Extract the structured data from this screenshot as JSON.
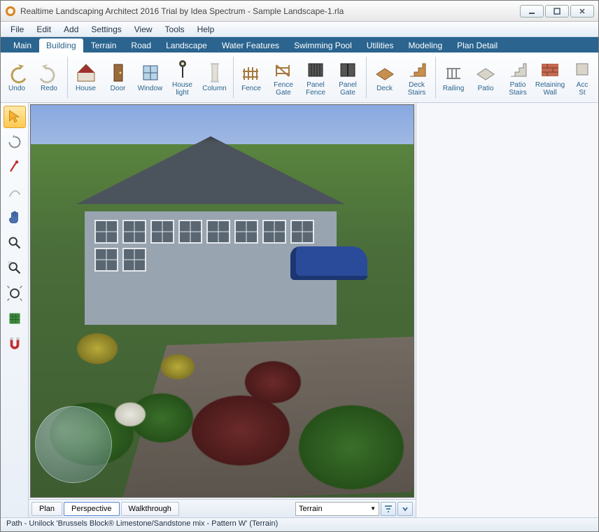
{
  "title": "Realtime Landscaping Architect 2016 Trial by Idea Spectrum - Sample Landscape-1.rla",
  "menus": [
    "File",
    "Edit",
    "Add",
    "Settings",
    "View",
    "Tools",
    "Help"
  ],
  "ribbon_tabs": [
    "Main",
    "Building",
    "Terrain",
    "Road",
    "Landscape",
    "Water Features",
    "Swimming Pool",
    "Utilities",
    "Modeling",
    "Plan Detail"
  ],
  "active_ribbon": 1,
  "tools_history": [
    {
      "label": "Undo",
      "icon": "undo-icon"
    },
    {
      "label": "Redo",
      "icon": "redo-icon"
    }
  ],
  "tools_building": [
    {
      "label": "House",
      "icon": "house-icon"
    },
    {
      "label": "Door",
      "icon": "door-icon"
    },
    {
      "label": "Window",
      "icon": "window-icon"
    },
    {
      "label": "House\nlight",
      "icon": "lamp-icon"
    },
    {
      "label": "Column",
      "icon": "column-icon"
    }
  ],
  "tools_fence": [
    {
      "label": "Fence",
      "icon": "fence-icon"
    },
    {
      "label": "Fence\nGate",
      "icon": "fence-gate-icon"
    },
    {
      "label": "Panel\nFence",
      "icon": "panel-fence-icon"
    },
    {
      "label": "Panel\nGate",
      "icon": "panel-gate-icon"
    }
  ],
  "tools_deck": [
    {
      "label": "Deck",
      "icon": "deck-icon"
    },
    {
      "label": "Deck\nStairs",
      "icon": "deck-stairs-icon"
    }
  ],
  "tools_patio": [
    {
      "label": "Railing",
      "icon": "railing-icon"
    },
    {
      "label": "Patio",
      "icon": "patio-icon"
    },
    {
      "label": "Patio\nStairs",
      "icon": "patio-stairs-icon"
    },
    {
      "label": "Retaining\nWall",
      "icon": "wall-icon"
    },
    {
      "label": "Acc\nSt",
      "icon": "accessory-icon"
    }
  ],
  "side_tools": [
    {
      "name": "select-tool",
      "active": true,
      "glyph": "arrow"
    },
    {
      "name": "orbit-tool",
      "active": false,
      "glyph": "rotate"
    },
    {
      "name": "move-point-tool",
      "active": false,
      "glyph": "point"
    },
    {
      "name": "curve-tool",
      "active": false,
      "glyph": "curve"
    },
    {
      "name": "pan-tool",
      "active": false,
      "glyph": "hand"
    },
    {
      "name": "zoom-tool",
      "active": false,
      "glyph": "zoom"
    },
    {
      "name": "zoom-selection-tool",
      "active": false,
      "glyph": "zoomsel"
    },
    {
      "name": "zoom-extents-tool",
      "active": false,
      "glyph": "zoomall"
    },
    {
      "name": "grid-tool",
      "active": false,
      "glyph": "grid"
    },
    {
      "name": "snap-tool",
      "active": false,
      "glyph": "magnet"
    }
  ],
  "view_tabs": [
    "Plan",
    "Perspective",
    "Walkthrough"
  ],
  "active_view": 1,
  "layer_select": "Terrain",
  "status": "Path - Unilock 'Brussels Block® Limestone/Sandstone mix - Pattern W' (Terrain)"
}
